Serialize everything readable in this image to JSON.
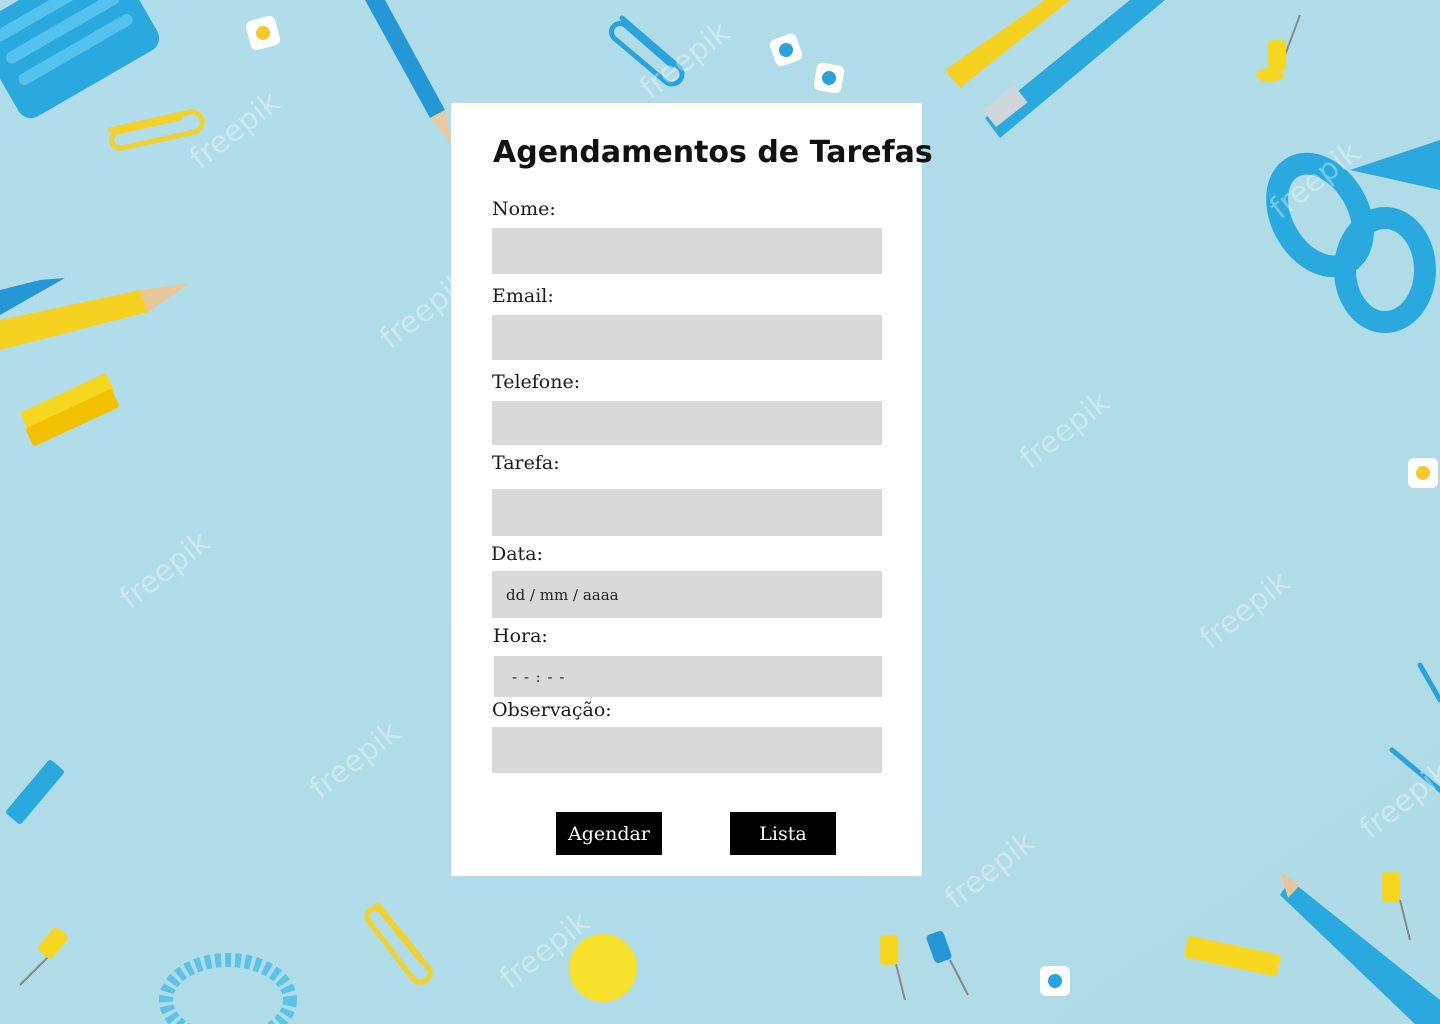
{
  "form": {
    "title": "Agendamentos de Tarefas",
    "fields": {
      "nome": {
        "label": "Nome:",
        "value": ""
      },
      "email": {
        "label": "Email:",
        "value": ""
      },
      "telefone": {
        "label": "Telefone:",
        "value": ""
      },
      "tarefa": {
        "label": "Tarefa:",
        "value": ""
      },
      "data": {
        "label": "Data:",
        "placeholder": "dd / mm / aaaa"
      },
      "hora": {
        "label": "Hora:",
        "placeholder": "- - : - -"
      },
      "observacao": {
        "label": "Observação:",
        "value": ""
      }
    },
    "buttons": {
      "agendar": "Agendar",
      "lista": "Lista"
    }
  },
  "background": {
    "watermark": "freepik",
    "colors": {
      "base": "#b6dfea",
      "blue": "#2aa9df",
      "yellow": "#f7d620"
    }
  }
}
